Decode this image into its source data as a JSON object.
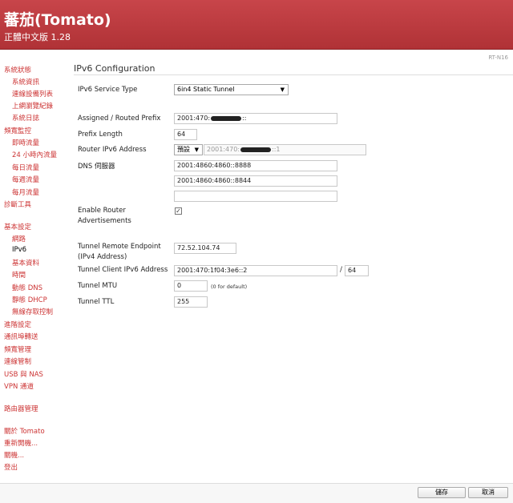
{
  "header": {
    "title": "蕃茄(Tomato)",
    "version": "正體中文版 1.28"
  },
  "model": "RT-N16",
  "sidebar": {
    "status": "系統狀態",
    "status_items": [
      "系統資訊",
      "連線設備列表",
      "上網瀏覽紀錄",
      "系統日誌"
    ],
    "bandwidth": "頻寬監控",
    "bandwidth_items": [
      "即時流量",
      "24 小時內流量",
      "每日流量",
      "每週流量",
      "每月流量"
    ],
    "diag": "診斷工具",
    "basic": "基本設定",
    "basic_items": [
      "網路",
      "IPv6",
      "基本資料",
      "時間",
      "動態 DNS",
      "靜態 DHCP",
      "無線存取控制"
    ],
    "advanced": "進階設定",
    "port_forward": "通訊埠轉送",
    "bw_manage": "頻寬管理",
    "access": "連線管制",
    "usb": "USB 與 NAS",
    "vpn": "VPN 通道",
    "admin": "路由器管理",
    "about": "關於 Tomato",
    "reboot": "重新開機...",
    "shutdown": "關機...",
    "logout": "登出"
  },
  "main": {
    "title": "IPv6 Configuration",
    "service_type_label": "IPv6 Service Type",
    "service_type_value": "6in4 Static Tunnel",
    "prefix_label": "Assigned / Routed Prefix",
    "prefix_value_a": "2001:470:",
    "prefix_value_b": "::",
    "prefix_length_label": "Prefix Length",
    "prefix_length_value": "64",
    "router_addr_label": "Router IPv6 Address",
    "router_addr_mode": "預設",
    "router_addr_value_a": "2001:470:",
    "router_addr_value_b": "::1",
    "dns_label": "DNS 伺服器",
    "dns1": "2001:4860:4860::8888",
    "dns2": "2001:4860:4860::8844",
    "dns3": "",
    "adv_label": "Enable Router Advertisements",
    "adv_checked": "✓",
    "endpoint_label": "Tunnel Remote Endpoint (IPv4 Address)",
    "endpoint_value": "72.52.104.74",
    "client_addr_label": "Tunnel Client IPv6 Address",
    "client_addr_value": "2001:470:1f04:3e6::2",
    "client_prefix": "64",
    "mtu_label": "Tunnel MTU",
    "mtu_value": "0",
    "mtu_hint": "(0 for default)",
    "ttl_label": "Tunnel TTL",
    "ttl_value": "255"
  },
  "footer": {
    "save": "儲存",
    "cancel": "取消"
  }
}
